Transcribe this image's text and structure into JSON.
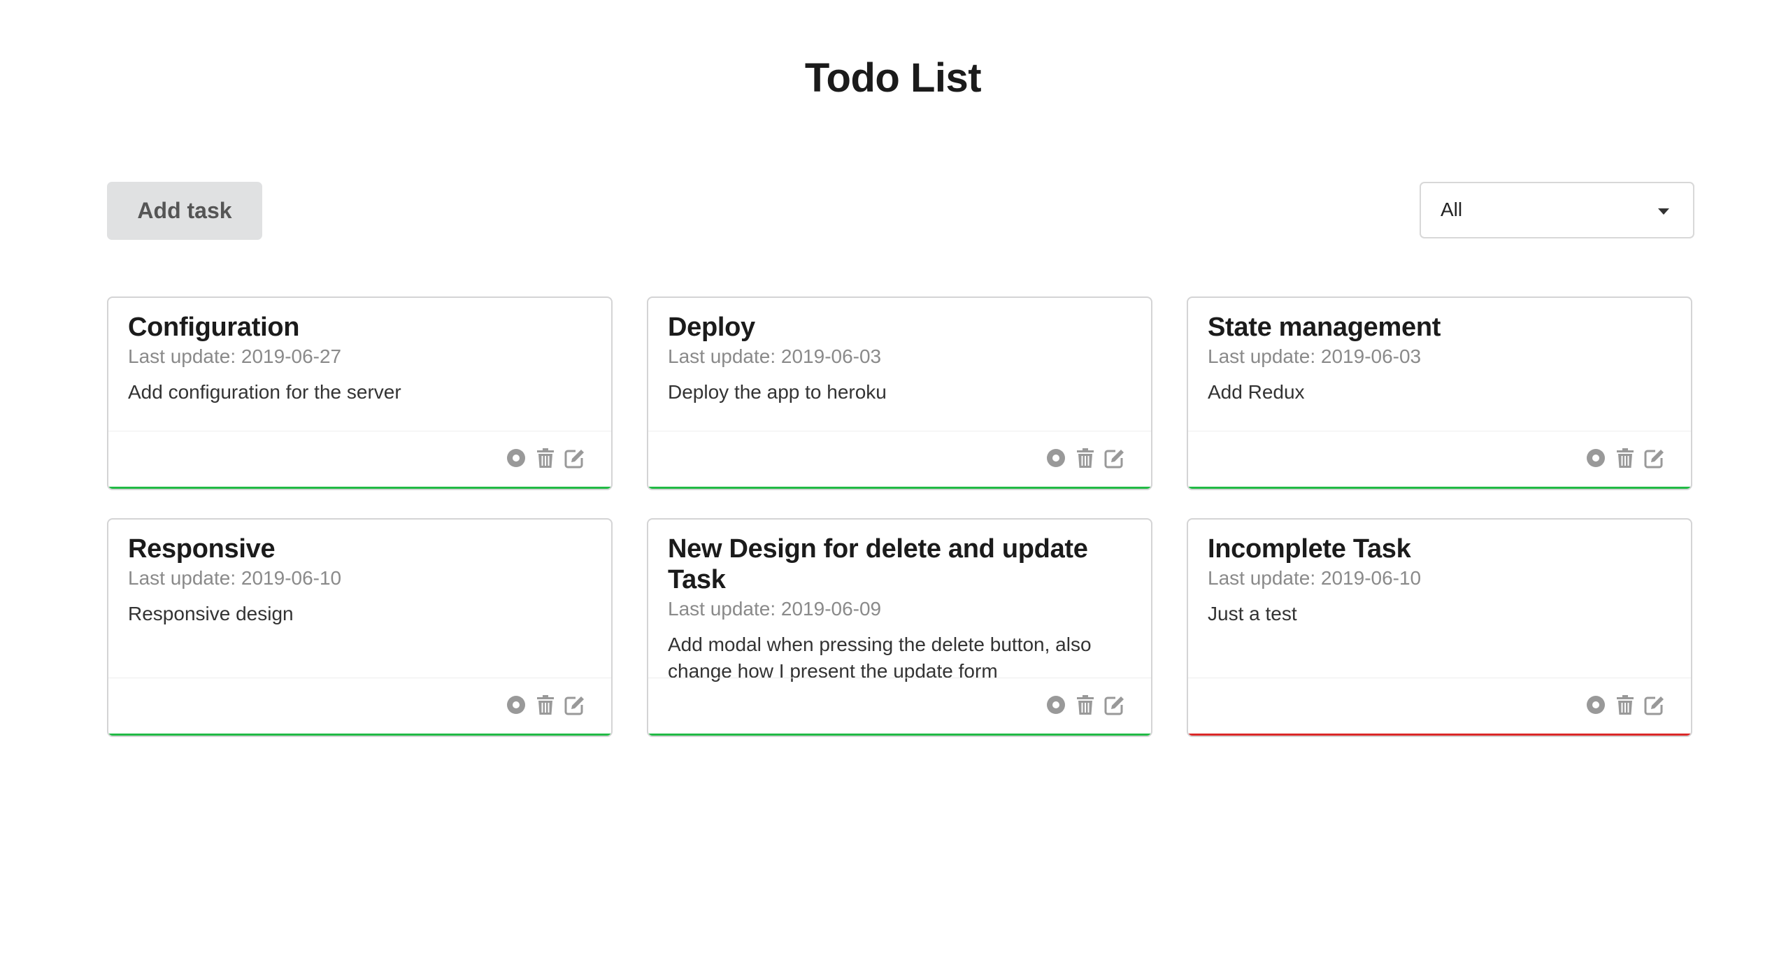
{
  "page": {
    "title": "Todo List"
  },
  "toolbar": {
    "add_label": "Add task",
    "filter": {
      "selected": "All"
    }
  },
  "colors": {
    "complete": "#21ba45",
    "incomplete": "#db2828",
    "icon": "#999999"
  },
  "icons": [
    "circle-icon",
    "trash-icon",
    "edit-icon"
  ],
  "tasks": [
    {
      "title": "Configuration",
      "updated": "Last update: 2019-06-27",
      "description": "Add configuration for the server",
      "status": "complete"
    },
    {
      "title": "Deploy",
      "updated": "Last update: 2019-06-03",
      "description": "Deploy the app to heroku",
      "status": "complete"
    },
    {
      "title": "State management",
      "updated": "Last update: 2019-06-03",
      "description": "Add Redux",
      "status": "complete"
    },
    {
      "title": "Responsive",
      "updated": "Last update: 2019-06-10",
      "description": "Responsive design",
      "status": "complete"
    },
    {
      "title": "New Design for delete and update Task",
      "updated": "Last update: 2019-06-09",
      "description": "Add modal when pressing the delete button, also change how I present the update form",
      "status": "complete"
    },
    {
      "title": "Incomplete Task",
      "updated": "Last update: 2019-06-10",
      "description": "Just a test",
      "status": "incomplete"
    }
  ]
}
